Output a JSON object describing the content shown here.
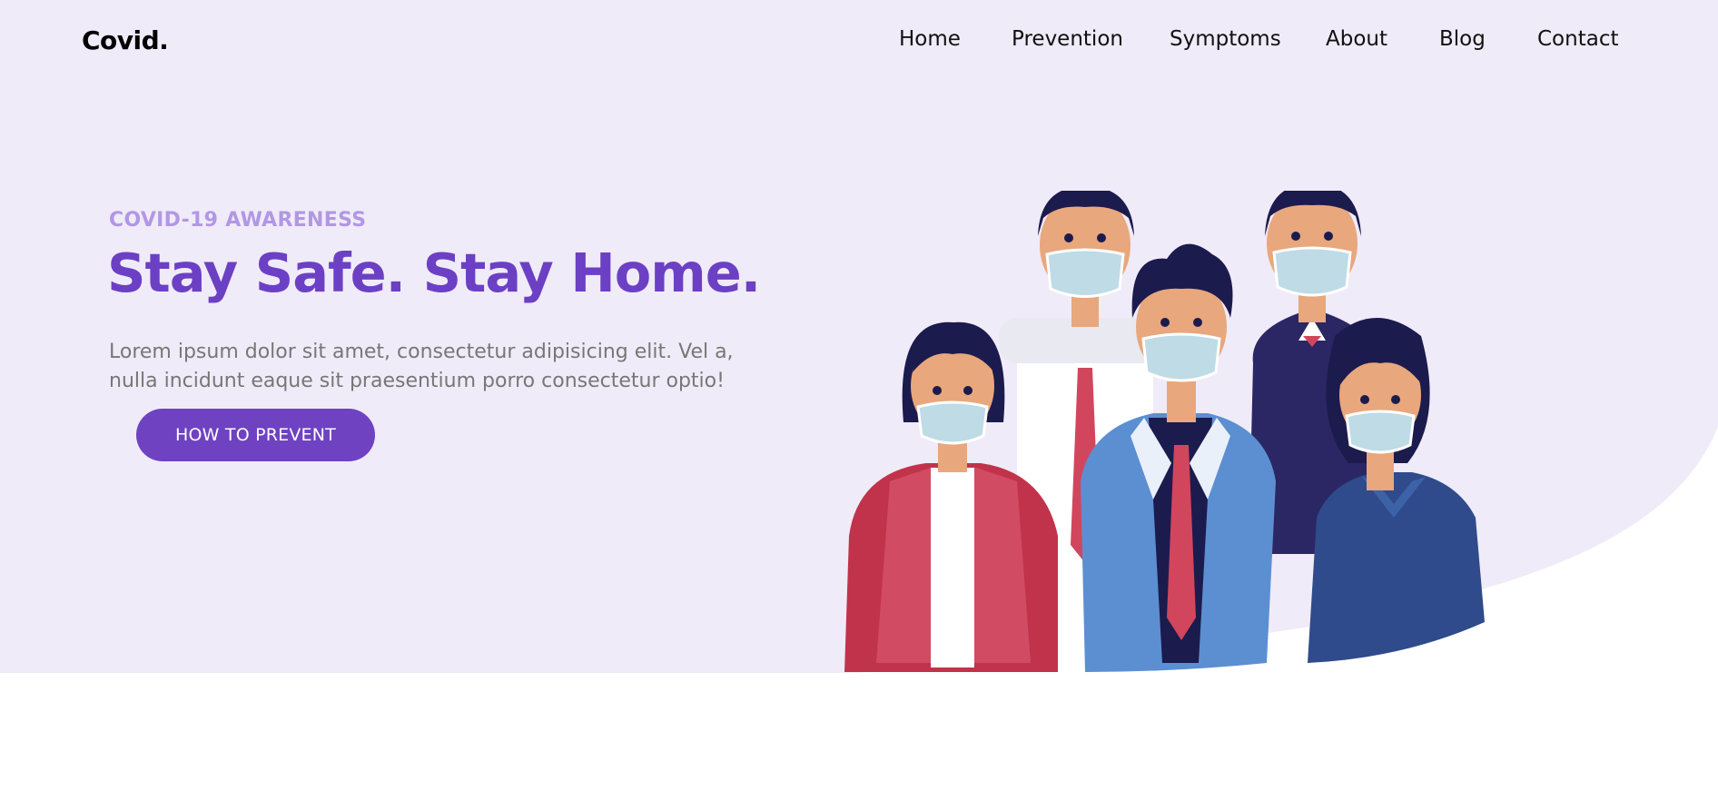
{
  "brand": {
    "logo": "Covid."
  },
  "nav": {
    "items": [
      {
        "label": "Home"
      },
      {
        "label": "Prevention"
      },
      {
        "label": "Symptoms"
      },
      {
        "label": "About"
      },
      {
        "label": "Blog"
      },
      {
        "label": "Contact"
      }
    ]
  },
  "hero": {
    "eyebrow": "COVID-19 AWARENESS",
    "title": "Stay Safe. Stay Home.",
    "description": "Lorem ipsum dolor sit amet, consectetur adipisicing elit. Vel a, nulla incidunt eaque sit praesentium porro consectetur optio!",
    "cta_label": "HOW TO PREVENT"
  },
  "colors": {
    "hero_bg": "#f0ebf8",
    "accent": "#6f42c1",
    "eyebrow": "#b197e4",
    "body_text": "#777777"
  },
  "illustration": {
    "icon": "masked-people-group-illustration"
  }
}
